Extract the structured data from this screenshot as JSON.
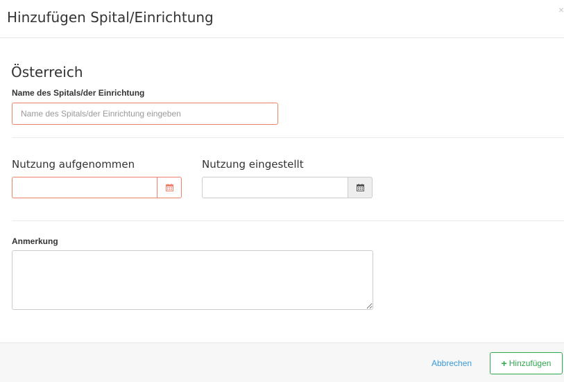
{
  "dialog": {
    "title": "Hinzufügen Spital/Einrichtung",
    "close_icon": "close-icon",
    "close_glyph": "×"
  },
  "form": {
    "country": "Österreich",
    "name_label": "Name des Spitals/der Einrichtung",
    "name_value": "",
    "name_placeholder": "Name des Spitals/der Einrichtung eingeben",
    "start_label": "Nutzung aufgenommen",
    "start_value": "",
    "end_label": "Nutzung eingestellt",
    "end_value": "",
    "calendar_icon": "calendar-icon",
    "note_label": "Anmerkung",
    "note_value": ""
  },
  "footer": {
    "cancel_label": "Abbrechen",
    "add_label": "Hinzufügen",
    "add_icon": "plus-icon",
    "add_glyph": "+"
  },
  "colors": {
    "error_border": "#f0816c",
    "link": "#3a9ad9",
    "success": "#2fa84f",
    "footer_bg": "#f7f7f7"
  }
}
